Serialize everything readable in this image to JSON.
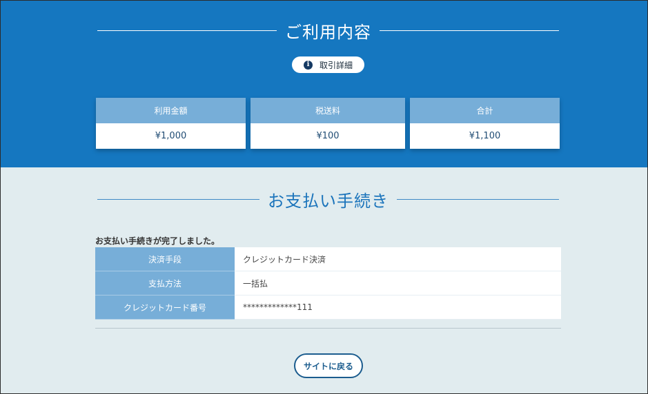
{
  "usage": {
    "title": "ご利用内容",
    "detail_button": "取引詳細",
    "cards": [
      {
        "label": "利用金額",
        "value": "¥1,000"
      },
      {
        "label": "税送料",
        "value": "¥100"
      },
      {
        "label": "合計",
        "value": "¥1,100"
      }
    ]
  },
  "payment": {
    "title": "お支払い手続き",
    "complete_message": "お支払い手続きが完了しました。",
    "rows": [
      {
        "label": "決済手段",
        "value": "クレジットカード決済"
      },
      {
        "label": "支払方法",
        "value": "一括払"
      },
      {
        "label": "クレジットカード番号",
        "value": "*************111"
      }
    ],
    "back_button": "サイトに戻る"
  },
  "colors": {
    "header_blue": "#1577c0",
    "light_blue": "#77aed8",
    "page_bg": "#e1ecef",
    "button_border": "#1b5c8e"
  },
  "icons": {
    "detail": "info-icon"
  }
}
